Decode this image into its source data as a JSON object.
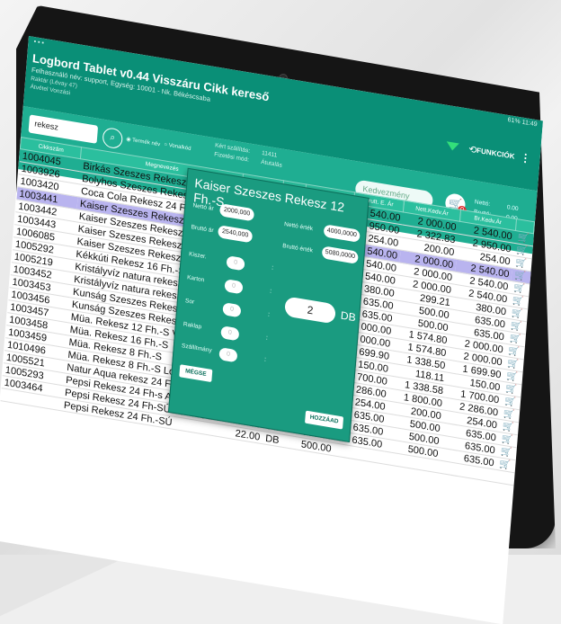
{
  "app": {
    "title": "Logbord Tablet v0.44 Visszáru Cikk kereső",
    "subtitle": "Felhasználó név: support, Egység: 10001 - Nk. Békéscsaba",
    "line3": "Raktár (Lévay 47)",
    "line4": "Átvétel Vonzási"
  },
  "toolbar": {
    "funkciok_label": "FUNKCIÓK",
    "more_icon": "⋮",
    "sync_icon": "⟲"
  },
  "search": {
    "value": "rekesz",
    "icon": "search-icon"
  },
  "radio": {
    "opt1": "Termék név",
    "opt2": "Vonalkód"
  },
  "meta": {
    "l1": "Kért szállítás:",
    "v1": "11411",
    "l2": "Fizetési mód:",
    "v2": "Átutalás"
  },
  "kedvezmeny_placeholder": "Kedvezmény",
  "cart": {
    "badge": "0"
  },
  "totals": {
    "netto_label": "Nettó:",
    "netto_value": "0.00",
    "brutto_label": "Bruttó:",
    "brutto_value": "0.00"
  },
  "columns": {
    "cikkszam": "Cikkszám",
    "megnevezes": "Megnevezés",
    "brutto_e_ar": "Brutt. E. Ár",
    "nett_kedv_ar": "Nett.Kedv.Ár",
    "br_kedv_ar": "Br.Kedv.Ár"
  },
  "rows": [
    {
      "code": "1004045",
      "name": "Birkás Szeszes Rekesz 12",
      "qty": "",
      "unit": "",
      "price": "",
      "brutto": "2 540.00",
      "nk": "2 000.00",
      "bk": "2 540.00"
    },
    {
      "code": "1003926",
      "name": "Bolyhos Szeszes Rekesz",
      "qty": "",
      "unit": "",
      "price": "",
      "brutto": "2 950.00",
      "nk": "2 322.83",
      "bk": "2 950.00"
    },
    {
      "code": "1003420",
      "name": "Coca Cola Rekesz 24 Fh",
      "qty": "",
      "unit": "",
      "price": "",
      "brutto": "254.00",
      "nk": "200.00",
      "bk": "254.00"
    },
    {
      "code": "1003441",
      "name": "Kaiser Szeszes Rekesz 12",
      "qty": "",
      "unit": "",
      "price": "",
      "brutto": "2 540.00",
      "nk": "2 000.00",
      "bk": "2 540.00",
      "sel": true
    },
    {
      "code": "1003442",
      "name": "Kaiser Szeszes Rekesz 24 Fh",
      "qty": "",
      "unit": "",
      "price": "",
      "brutto": "2 540.00",
      "nk": "2 000.00",
      "bk": "2 540.00"
    },
    {
      "code": "1003443",
      "name": "Kaiser Szeszes Rekesz 1",
      "qty": "",
      "unit": "",
      "price": "",
      "brutto": "2 540.00",
      "nk": "2 000.00",
      "bk": "2 540.00"
    },
    {
      "code": "1006085",
      "name": "Kaiser Szeszes Rekesz",
      "qty": "",
      "unit": "",
      "price": "",
      "brutto": "380.00",
      "nk": "299.21",
      "bk": "380.00"
    },
    {
      "code": "1005292",
      "name": "Kékkúti Rekesz 16 Fh.-S",
      "qty": "",
      "unit": "",
      "price": "",
      "brutto": "635.00",
      "nk": "500.00",
      "bk": "635.00"
    },
    {
      "code": "1005219",
      "name": "Kristályvíz natura rekesz",
      "qty": "",
      "unit": "",
      "price": "",
      "brutto": "635.00",
      "nk": "500.00",
      "bk": "635.00"
    },
    {
      "code": "1003452",
      "name": "Kristályvíz natura rekesz",
      "qty": "",
      "unit": "",
      "price": "",
      "brutto": "2 000.00",
      "nk": "1 574.80",
      "bk": "2 000.00"
    },
    {
      "code": "1003453",
      "name": "Kunság Szeszes Rekesz",
      "qty": "",
      "unit": "",
      "price": "",
      "brutto": "2 000.00",
      "nk": "1 574.80",
      "bk": "2 000.00"
    },
    {
      "code": "1003456",
      "name": "Kunság Szeszes Rekesz",
      "qty": "",
      "unit": "",
      "price": "",
      "brutto": "1 699.90",
      "nk": "1 338.50",
      "bk": "1 699.90"
    },
    {
      "code": "1003457",
      "name": "Müa. Rekesz 12 Fh.-S VAL",
      "qty": "",
      "unit": "",
      "price": "",
      "brutto": "150.00",
      "nk": "118.11",
      "bk": "150.00"
    },
    {
      "code": "1003458",
      "name": "Müa. Rekesz 16 Fh.-S",
      "qty": "",
      "unit": "",
      "price": "",
      "brutto": "1 700.00",
      "nk": "1 338.58",
      "bk": "1 700.00"
    },
    {
      "code": "1003459",
      "name": "Müa. Rekesz 8 Fh.-S",
      "qty": "",
      "unit": "",
      "price": "",
      "brutto": "2 286.00",
      "nk": "1 800.00",
      "bk": "2 286.00"
    },
    {
      "code": "1010496",
      "name": "Müa. Rekesz 8 Fh.-S Lovassy",
      "qty": "120.00",
      "unit": "DB",
      "price": "",
      "brutto": "254.00",
      "nk": "200.00",
      "bk": "254.00"
    },
    {
      "code": "1005521",
      "name": "Natur Aqua rekesz 24 Fh.",
      "qty": "273.00",
      "unit": "DB",
      "price": "1 800.00",
      "brutto": "635.00",
      "nk": "500.00",
      "bk": "635.00"
    },
    {
      "code": "1005293",
      "name": "Pepsi Rekesz 24 Fh-s AXL2014",
      "qty": "1.00",
      "unit": "DB",
      "price": "200.00",
      "brutto": "635.00",
      "nk": "500.00",
      "bk": "635.00"
    },
    {
      "code": "1003464",
      "name": "Pepsi Rekesz 24 Fh-SÚJ CAROLIT",
      "qty": "17.00",
      "unit": "DB",
      "price": "500.00",
      "brutto": "635.00",
      "nk": "500.00",
      "bk": "635.00"
    },
    {
      "code": "",
      "name": "Pepsi Rekesz 24 Fh.-SÚ",
      "qty": "22.00",
      "unit": "DB",
      "price": "500.00",
      "brutto": "",
      "nk": "",
      "bk": ""
    }
  ],
  "modal": {
    "title": "Kaiser Szeszes Rekesz 12 Fh.-S",
    "netto_ar_label": "Nettó ár",
    "netto_ar": "2000,000",
    "brutto_ar_label": "Bruttó ár",
    "brutto_ar": "2540,000",
    "netto_ertek_label": "Nettó érték",
    "netto_ertek": "4000,0000",
    "brutto_ertek_label": "Bruttó érték",
    "brutto_ertek": "5080,0000",
    "kiszereles_label": "Kiszer.",
    "karton_label": "Karton",
    "sor_label": "Sor",
    "raklap_label": "Raklap",
    "szallitmany_label": "Szállítmány",
    "zero": "0",
    "quantity": "2",
    "unit": "DB",
    "cancel_label": "MÉGSE",
    "add_label": "HOZZÁAD"
  },
  "status": {
    "battery": "61%",
    "time": "11:49"
  }
}
